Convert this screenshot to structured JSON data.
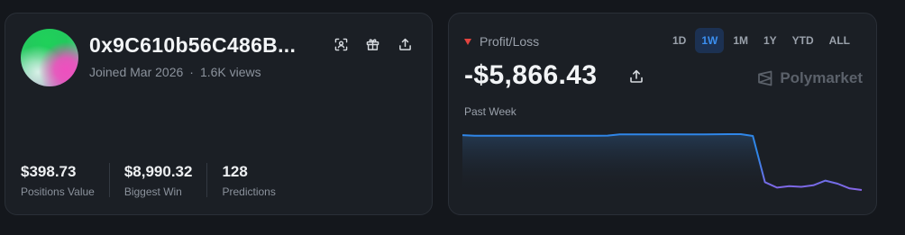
{
  "profile": {
    "username": "0x9C610b56C486B...",
    "joined": "Joined Mar 2026",
    "views": "1.6K views",
    "separator": "·",
    "stats": [
      {
        "value": "$398.73",
        "label": "Positions Value"
      },
      {
        "value": "$8,990.32",
        "label": "Biggest Win"
      },
      {
        "value": "128",
        "label": "Predictions"
      }
    ],
    "icons": [
      "scan-icon",
      "gift-icon",
      "share-icon"
    ]
  },
  "pnl": {
    "title": "Profit/Loss",
    "value": "-$5,866.43",
    "period": "Past Week",
    "brand": "Polymarket",
    "ranges": [
      "1D",
      "1W",
      "1M",
      "1Y",
      "YTD",
      "ALL"
    ],
    "active_range": "1W",
    "indicator_color": "#e3443f"
  },
  "chart_data": {
    "type": "line",
    "title": "",
    "xlabel": "",
    "ylabel": "",
    "x": [
      0,
      1,
      2,
      3,
      4,
      5,
      6,
      7,
      8,
      9,
      10,
      11,
      12,
      13,
      14,
      15,
      16,
      17,
      18,
      19,
      20,
      21,
      22,
      23,
      24,
      25,
      26,
      27,
      28,
      29,
      30,
      31,
      32,
      33
    ],
    "values": [
      100,
      99.2,
      99.2,
      99.2,
      99.2,
      99.3,
      99.4,
      99.4,
      99.4,
      99.4,
      99.4,
      99.4,
      99.5,
      101,
      101,
      101,
      101,
      101,
      101,
      101,
      101.1,
      101.2,
      101.3,
      101.3,
      99,
      40,
      33,
      35,
      34,
      36,
      42,
      38,
      32,
      30
    ],
    "line_color_top": "#2f86e8",
    "line_color_bottom": "#8f62e6",
    "grid": false
  }
}
